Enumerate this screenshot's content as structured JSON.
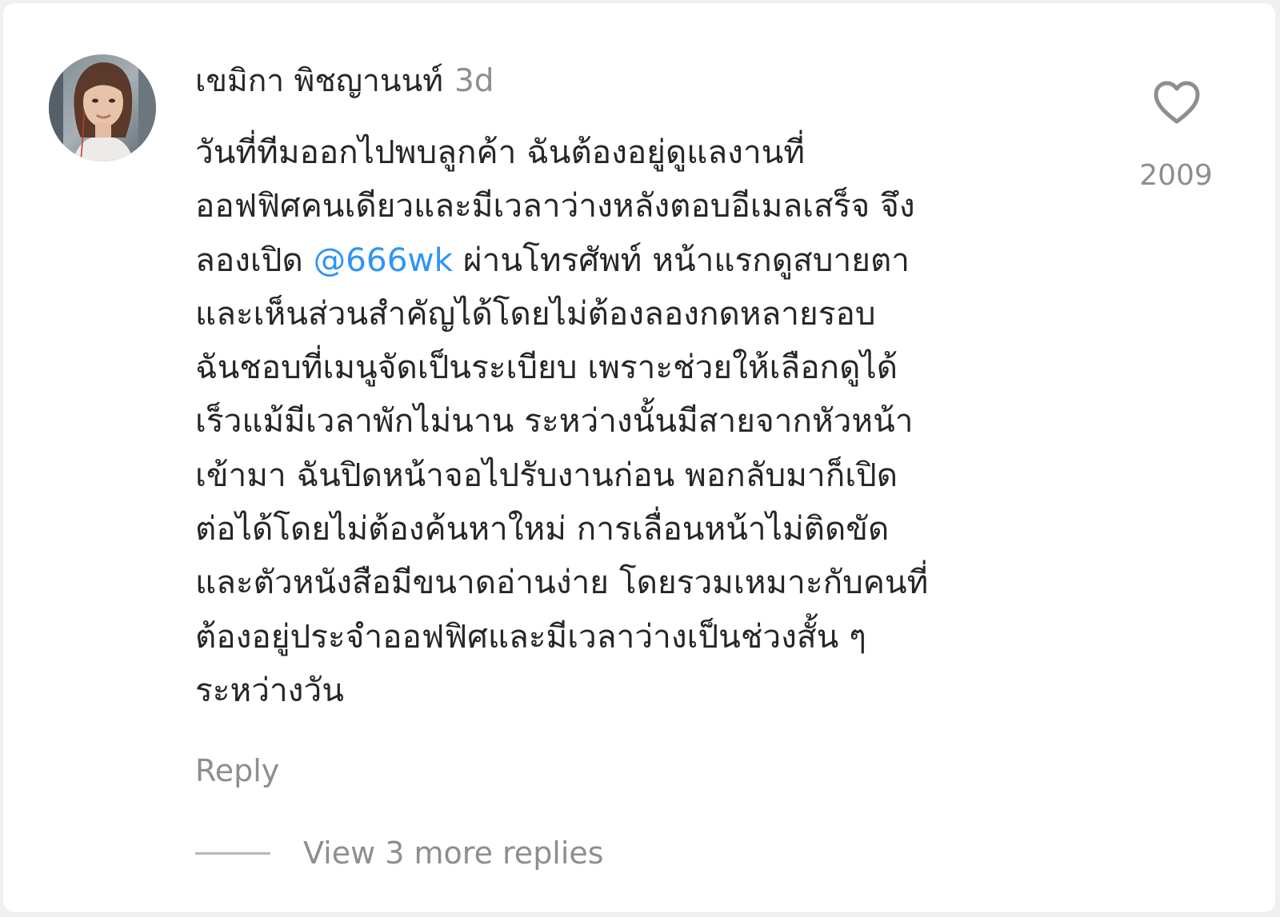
{
  "comment": {
    "username": "เขมิกา พิชญานนท์",
    "timestamp": "3d",
    "lines": [
      {
        "text": "วันที่ทีมออกไปพบลูกค้า ฉันต้องอยู่ดูแลงานที่"
      },
      {
        "text": "ออฟฟิศคนเดียวและมีเวลาว่างหลังตอบอีเมลเสร็จ จึง"
      },
      {
        "before": "ลองเปิด ",
        "mention": "@666wk",
        "after": " ผ่านโทรศัพท์ หน้าแรกดูสบายตา"
      },
      {
        "text": "และเห็นส่วนสำคัญได้โดยไม่ต้องลองกดหลายรอบ"
      },
      {
        "text": "ฉันชอบที่เมนูจัดเป็นระเบียบ เพราะช่วยให้เลือกดูได้"
      },
      {
        "text": "เร็วแม้มีเวลาพักไม่นาน ระหว่างนั้นมีสายจากหัวหน้า"
      },
      {
        "text": "เข้ามา ฉันปิดหน้าจอไปรับงานก่อน พอกลับมาก็เปิด"
      },
      {
        "text": "ต่อได้โดยไม่ต้องค้นหาใหม่ การเลื่อนหน้าไม่ติดขัด"
      },
      {
        "text": "และตัวหนังสือมีขนาดอ่านง่าย โดยรวมเหมาะกับคนที่"
      },
      {
        "text": "ต้องอยู่ประจำออฟฟิศและมีเวลาว่างเป็นช่วงสั้น ๆ"
      },
      {
        "text": "ระหว่างวัน"
      }
    ],
    "like_count": "2009",
    "like_icon": "heart-outline-icon",
    "reply_label": "Reply",
    "view_replies_label": "View 3 more replies"
  },
  "colors": {
    "text": "#262626",
    "muted": "#8e8e8e",
    "mention": "#2f95f5",
    "background": "#ffffff"
  }
}
